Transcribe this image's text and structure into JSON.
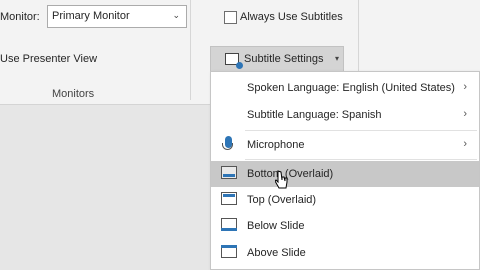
{
  "ribbon": {
    "monitor_label": "Monitor:",
    "monitor_value": "Primary Monitor",
    "presenter_view": "Use Presenter View",
    "group_title": "Monitors",
    "always_use_subtitles": "Always Use Subtitles",
    "always_use_subtitles_checked": false,
    "subtitle_settings": "Subtitle Settings"
  },
  "menu": {
    "spoken_language": "Spoken Language: English (United States)",
    "subtitle_language": "Subtitle Language: Spanish",
    "microphone": "Microphone",
    "bottom_overlaid": "Bottom (Overlaid)",
    "top_overlaid": "Top (Overlaid)",
    "below_slide": "Below Slide",
    "above_slide": "Above Slide",
    "arrow_glyph": "›"
  },
  "colors": {
    "accent": "#2e75b6",
    "highlight": "#c8c8c8",
    "ribbon_bg": "#f3f3f3",
    "workspace_bg": "#e6e6e6"
  }
}
